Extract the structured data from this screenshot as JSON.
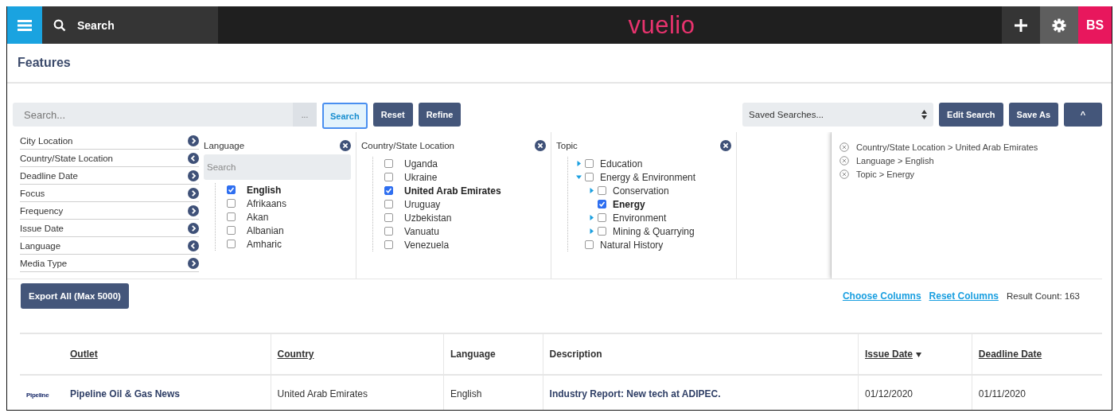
{
  "topbar": {
    "search_label": "Search",
    "logo": "vuelio",
    "avatar": "BS"
  },
  "page_title": "Features",
  "search": {
    "placeholder": "Search...",
    "more": "..."
  },
  "buttons": [
    {
      "label": "Search",
      "selected": true
    },
    {
      "label": "Reset",
      "selected": false
    },
    {
      "label": "Refine",
      "selected": false
    }
  ],
  "saved_searches": {
    "value": "Saved Searches..."
  },
  "right_buttons": [
    "Edit Search",
    "Save As",
    "^"
  ],
  "facets": [
    {
      "label": "City Location",
      "expanded": false
    },
    {
      "label": "Country/State Location",
      "expanded": true
    },
    {
      "label": "Deadline Date",
      "expanded": false
    },
    {
      "label": "Focus",
      "expanded": false
    },
    {
      "label": "Frequency",
      "expanded": false
    },
    {
      "label": "Issue Date",
      "expanded": false
    },
    {
      "label": "Language",
      "expanded": true
    },
    {
      "label": "Media Type",
      "expanded": false
    }
  ],
  "panels": [
    {
      "title": "Language",
      "kind": "list",
      "search_placeholder": "Search",
      "items": [
        {
          "label": "English",
          "checked": true
        },
        {
          "label": "Afrikaans",
          "checked": false
        },
        {
          "label": "Akan",
          "checked": false
        },
        {
          "label": "Albanian",
          "checked": false
        },
        {
          "label": "Amharic",
          "checked": false
        }
      ]
    },
    {
      "title": "Country/State Location",
      "kind": "list",
      "items": [
        {
          "label": "Uganda",
          "checked": false
        },
        {
          "label": "Ukraine",
          "checked": false
        },
        {
          "label": "United Arab Emirates",
          "checked": true
        },
        {
          "label": "Uruguay",
          "checked": false
        },
        {
          "label": "Uzbekistan",
          "checked": false
        },
        {
          "label": "Vanuatu",
          "checked": false
        },
        {
          "label": "Venezuela",
          "checked": false
        }
      ]
    },
    {
      "title": "Topic",
      "kind": "tree",
      "items": [
        {
          "label": "Education",
          "checked": false,
          "expanded": false
        },
        {
          "label": "Energy & Environment",
          "checked": false,
          "expanded": true,
          "children": [
            {
              "label": "Conservation",
              "checked": false,
              "expanded": false
            },
            {
              "label": "Energy",
              "checked": true
            },
            {
              "label": "Environment",
              "checked": false,
              "expanded": false
            },
            {
              "label": "Mining & Quarrying",
              "checked": false,
              "expanded": false
            }
          ]
        },
        {
          "label": "Natural History",
          "checked": false
        }
      ]
    }
  ],
  "criteria": [
    "Country/State Location > United Arab Emirates",
    "Language > English",
    "Topic > Energy"
  ],
  "export_button": "Export All (Max 5000)",
  "links": [
    "Choose Columns",
    "Reset Columns"
  ],
  "result_count": "Result Count: 163",
  "table": {
    "columns": [
      {
        "label": "Outlet",
        "link": true,
        "sorted": false
      },
      {
        "label": "Country",
        "link": true,
        "sorted": false
      },
      {
        "label": "Language",
        "link": false,
        "sorted": false
      },
      {
        "label": "Description",
        "link": false,
        "sorted": false
      },
      {
        "label": "Issue Date",
        "link": true,
        "sorted": true
      },
      {
        "label": "Deadline Date",
        "link": true,
        "sorted": false
      }
    ],
    "rows": [
      {
        "logo": "Pipeline",
        "cells": [
          {
            "text": "Pipeline Oil & Gas News",
            "kind": "link"
          },
          {
            "text": "United Arab Emirates",
            "kind": "plain"
          },
          {
            "text": "English",
            "kind": "plain"
          },
          {
            "text": "Industry Report: New tech at ADIPEC.",
            "kind": "link"
          },
          {
            "text": "01/12/2020",
            "kind": "plain"
          },
          {
            "text": "01/11/2020",
            "kind": "plain"
          }
        ]
      }
    ]
  }
}
